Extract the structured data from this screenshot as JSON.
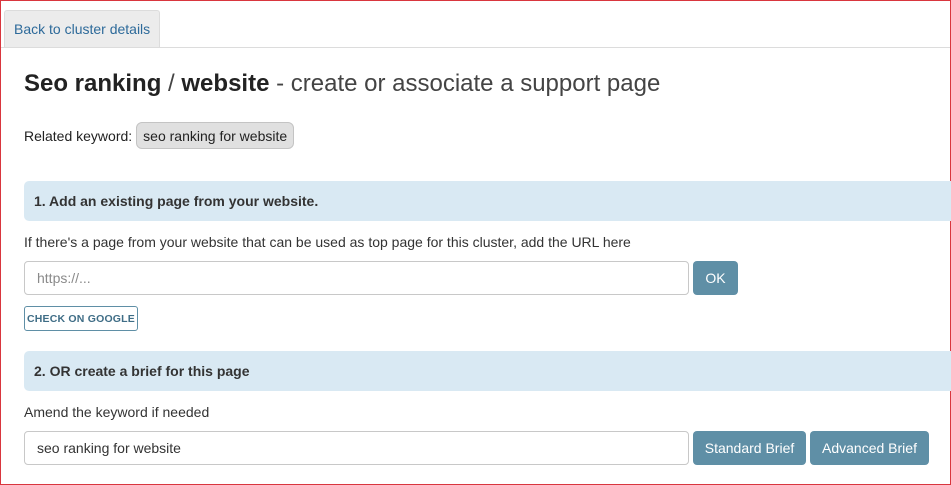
{
  "nav": {
    "back_tab_label": "Back to cluster details"
  },
  "header": {
    "title_part1": "Seo ranking",
    "separator": "/",
    "title_part2": "website",
    "subtitle": "- create or associate a support page"
  },
  "related": {
    "label": "Related keyword:",
    "keyword": "seo ranking for website"
  },
  "section1": {
    "heading": "1. Add an existing page from your website.",
    "description": "If there's a page from your website that can be used as top page for this cluster, add the URL here",
    "url_input": {
      "value": "",
      "placeholder": "https://..."
    },
    "ok_label": "OK",
    "check_google_label": "CHECK ON GOOGLE"
  },
  "section2": {
    "heading": "2. OR create a brief for this page",
    "description": "Amend the keyword if needed",
    "keyword_input": {
      "value": "seo ranking for website",
      "placeholder": ""
    },
    "standard_brief_label": "Standard Brief",
    "advanced_brief_label": "Advanced Brief"
  },
  "colors": {
    "accent": "#5f8fa6",
    "section_bg": "#d9e9f3",
    "link": "#2d6a9a",
    "window_border": "#d9363e"
  }
}
